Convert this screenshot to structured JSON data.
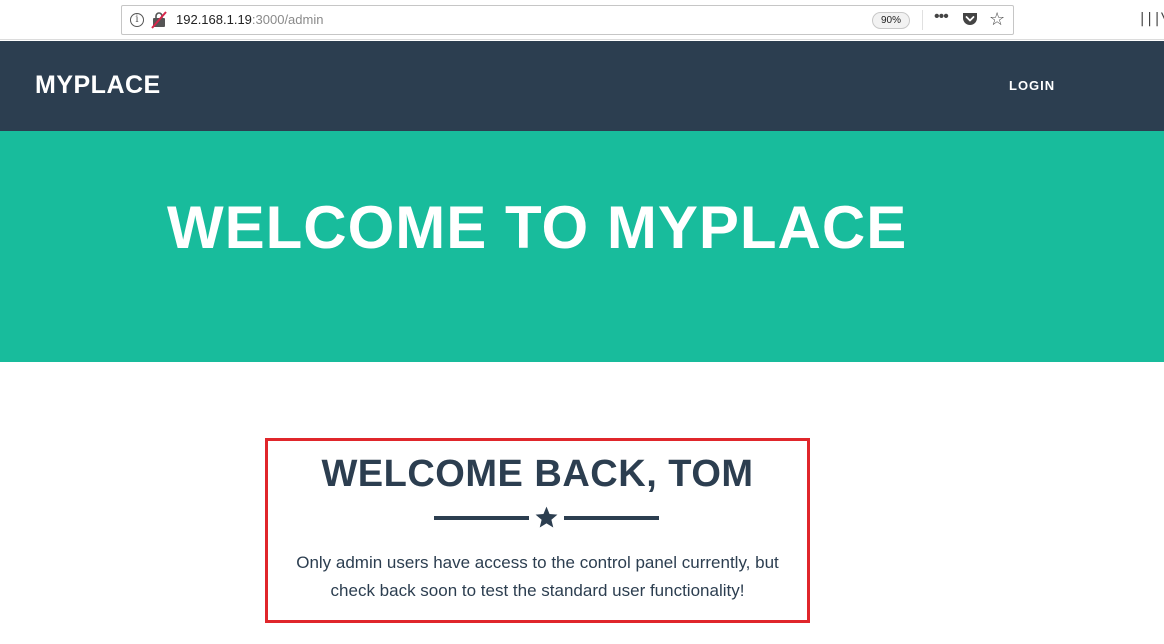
{
  "browser": {
    "info_icon": "i",
    "url_host": "192.168.1.19",
    "url_path": ":3000/admin",
    "zoom": "90%",
    "more_icon": "•••",
    "bookmark_icon": "☆",
    "library_icon": "|||\\"
  },
  "nav": {
    "brand": "MYPLACE",
    "login_label": "LOGIN"
  },
  "hero": {
    "title": "WELCOME TO MYPLACE"
  },
  "welcome": {
    "title": "WELCOME BACK, TOM",
    "message": "Only admin users have access to the control panel currently, but check back soon to test the standard user functionality!"
  },
  "colors": {
    "nav_bg": "#2c3e50",
    "hero_bg": "#18bc9c",
    "highlight_border": "#e0262b",
    "text_dark": "#2c3e50"
  }
}
